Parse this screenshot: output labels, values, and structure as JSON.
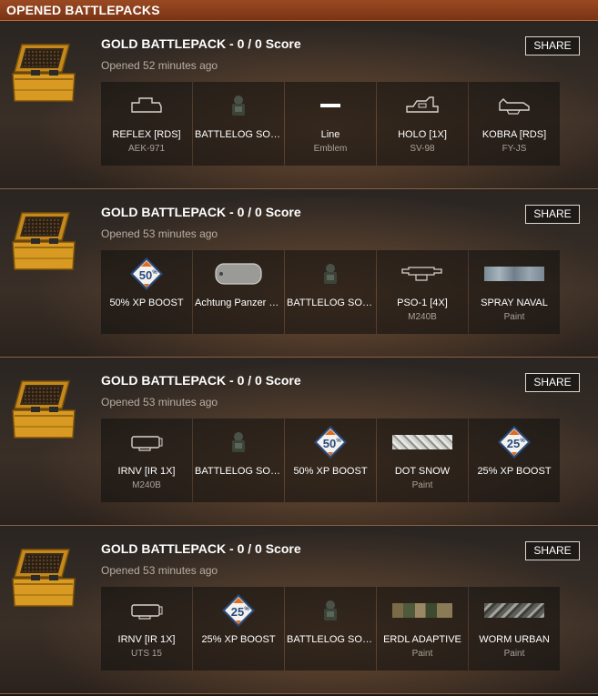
{
  "header": {
    "title": "OPENED BATTLEPACKS"
  },
  "colors": {
    "accent": "#9a4a22",
    "boost_orange": "#e06a1e",
    "boost_blue": "#2a4a7a"
  },
  "packs": [
    {
      "title": "GOLD BATTLEPACK - 0 / 0 Score",
      "time": "Opened 52 minutes ago",
      "share": "SHARE",
      "items": [
        {
          "name": "REFLEX [RDS]",
          "sub": "AEK-971",
          "icon": "reflex-sight-icon"
        },
        {
          "name": "BATTLELOG SOL...",
          "sub": "",
          "icon": "soldier-icon"
        },
        {
          "name": "Line",
          "sub": "Emblem",
          "icon": "line-emblem-icon"
        },
        {
          "name": "HOLO [1X]",
          "sub": "SV-98",
          "icon": "holo-sight-icon"
        },
        {
          "name": "KOBRA [RDS]",
          "sub": "FY-JS",
          "icon": "kobra-sight-icon"
        }
      ]
    },
    {
      "title": "GOLD BATTLEPACK - 0 / 0 Score",
      "time": "Opened 53 minutes ago",
      "share": "SHARE",
      "items": [
        {
          "name": "50% XP BOOST",
          "sub": "",
          "icon": "xp-boost-icon",
          "boost": "50"
        },
        {
          "name": "Achtung Panzer D...",
          "sub": "",
          "icon": "dogtag-icon"
        },
        {
          "name": "BATTLELOG SOL...",
          "sub": "",
          "icon": "soldier-icon"
        },
        {
          "name": "PSO-1 [4X]",
          "sub": "M240B",
          "icon": "scope-icon"
        },
        {
          "name": "SPRAY NAVAL",
          "sub": "Paint",
          "icon": "paint-swatch-icon",
          "paint": "naval"
        }
      ]
    },
    {
      "title": "GOLD BATTLEPACK - 0 / 0 Score",
      "time": "Opened 53 minutes ago",
      "share": "SHARE",
      "items": [
        {
          "name": "IRNV [IR 1X]",
          "sub": "M240B",
          "icon": "irnv-sight-icon"
        },
        {
          "name": "BATTLELOG SOL...",
          "sub": "",
          "icon": "soldier-icon"
        },
        {
          "name": "50% XP BOOST",
          "sub": "",
          "icon": "xp-boost-icon",
          "boost": "50"
        },
        {
          "name": "DOT SNOW",
          "sub": "Paint",
          "icon": "paint-swatch-icon",
          "paint": "snow"
        },
        {
          "name": "25% XP BOOST",
          "sub": "",
          "icon": "xp-boost-icon",
          "boost": "25"
        }
      ]
    },
    {
      "title": "GOLD BATTLEPACK - 0 / 0 Score",
      "time": "Opened 53 minutes ago",
      "share": "SHARE",
      "items": [
        {
          "name": "IRNV [IR 1X]",
          "sub": "UTS 15",
          "icon": "irnv-sight-icon"
        },
        {
          "name": "25% XP BOOST",
          "sub": "",
          "icon": "xp-boost-icon",
          "boost": "25"
        },
        {
          "name": "BATTLELOG SOL...",
          "sub": "",
          "icon": "soldier-icon"
        },
        {
          "name": "ERDL ADAPTIVE",
          "sub": "Paint",
          "icon": "paint-swatch-icon",
          "paint": "erdl"
        },
        {
          "name": "WORM URBAN",
          "sub": "Paint",
          "icon": "paint-swatch-icon",
          "paint": "worm"
        }
      ]
    }
  ]
}
